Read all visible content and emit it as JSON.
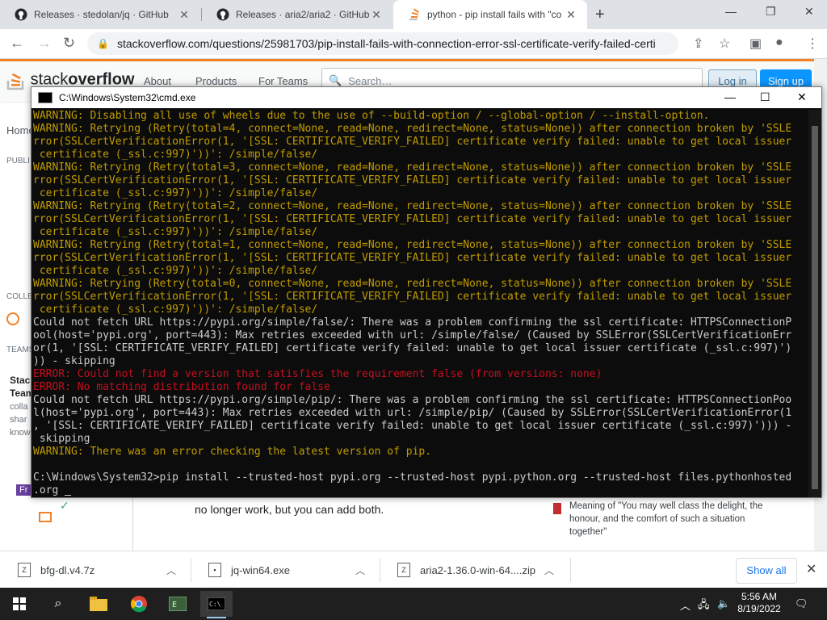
{
  "browser": {
    "tabs": [
      {
        "title": "Releases · stedolan/jq · GitHub",
        "icon": "github-icon"
      },
      {
        "title": "Releases · aria2/aria2 · GitHub",
        "icon": "github-icon"
      },
      {
        "title": "python - pip install fails with \"co",
        "icon": "stackoverflow-icon"
      }
    ],
    "new_tab": "+",
    "url": "stackoverflow.com/questions/25981703/pip-install-fails-with-connection-error-ssl-certificate-verify-failed-certi"
  },
  "so": {
    "logo_a": "stack",
    "logo_b": "overflow",
    "nav": [
      "About",
      "Products",
      "For Teams"
    ],
    "search_placeholder": "Search…",
    "login": "Log in",
    "signup": "Sign up",
    "sidebar": {
      "home": "Home",
      "publi": "PUBLI",
      "colle": "COLLE",
      "teams": "TEAMS",
      "stac": "Stac",
      "team": "Team",
      "colla": "colla",
      "shar": "shar",
      "know": "know",
      "fr": "Fr"
    },
    "answer_text": "no longer work, but you can add both.",
    "meaning_text": "Meaning of \"You may well class the delight, the honour, and the comfort of such a situation together\""
  },
  "cmd": {
    "title": "C:\\Windows\\System32\\cmd.exe",
    "lines": [
      {
        "t": "WARNING: Disabling all use of wheels due to the use of --build-option / --global-option / --install-option.",
        "c": "c-warn"
      },
      {
        "t": "WARNING: Retrying (Retry(total=4, connect=None, read=None, redirect=None, status=None)) after connection broken by 'SSLE",
        "c": "c-warn"
      },
      {
        "t": "rror(SSLCertVerificationError(1, '[SSL: CERTIFICATE_VERIFY_FAILED] certificate verify failed: unable to get local issuer",
        "c": "c-warn"
      },
      {
        "t": " certificate (_ssl.c:997)'))': /simple/false/",
        "c": "c-warn"
      },
      {
        "t": "WARNING: Retrying (Retry(total=3, connect=None, read=None, redirect=None, status=None)) after connection broken by 'SSLE",
        "c": "c-warn"
      },
      {
        "t": "rror(SSLCertVerificationError(1, '[SSL: CERTIFICATE_VERIFY_FAILED] certificate verify failed: unable to get local issuer",
        "c": "c-warn"
      },
      {
        "t": " certificate (_ssl.c:997)'))': /simple/false/",
        "c": "c-warn"
      },
      {
        "t": "WARNING: Retrying (Retry(total=2, connect=None, read=None, redirect=None, status=None)) after connection broken by 'SSLE",
        "c": "c-warn"
      },
      {
        "t": "rror(SSLCertVerificationError(1, '[SSL: CERTIFICATE_VERIFY_FAILED] certificate verify failed: unable to get local issuer",
        "c": "c-warn"
      },
      {
        "t": " certificate (_ssl.c:997)'))': /simple/false/",
        "c": "c-warn"
      },
      {
        "t": "WARNING: Retrying (Retry(total=1, connect=None, read=None, redirect=None, status=None)) after connection broken by 'SSLE",
        "c": "c-warn"
      },
      {
        "t": "rror(SSLCertVerificationError(1, '[SSL: CERTIFICATE_VERIFY_FAILED] certificate verify failed: unable to get local issuer",
        "c": "c-warn"
      },
      {
        "t": " certificate (_ssl.c:997)'))': /simple/false/",
        "c": "c-warn"
      },
      {
        "t": "WARNING: Retrying (Retry(total=0, connect=None, read=None, redirect=None, status=None)) after connection broken by 'SSLE",
        "c": "c-warn"
      },
      {
        "t": "rror(SSLCertVerificationError(1, '[SSL: CERTIFICATE_VERIFY_FAILED] certificate verify failed: unable to get local issuer",
        "c": "c-warn"
      },
      {
        "t": " certificate (_ssl.c:997)'))': /simple/false/",
        "c": "c-warn"
      },
      {
        "t": "Could not fetch URL https://pypi.org/simple/false/: There was a problem confirming the ssl certificate: HTTPSConnectionP",
        "c": "c-white"
      },
      {
        "t": "ool(host='pypi.org', port=443): Max retries exceeded with url: /simple/false/ (Caused by SSLError(SSLCertVerificationErr",
        "c": "c-white"
      },
      {
        "t": "or(1, '[SSL: CERTIFICATE_VERIFY_FAILED] certificate verify failed: unable to get local issuer certificate (_ssl.c:997)')",
        "c": "c-white"
      },
      {
        "t": ")) - skipping",
        "c": "c-white"
      },
      {
        "t": "ERROR: Could not find a version that satisfies the requirement false (from versions: none)",
        "c": "c-err"
      },
      {
        "t": "ERROR: No matching distribution found for false",
        "c": "c-err"
      },
      {
        "t": "Could not fetch URL https://pypi.org/simple/pip/: There was a problem confirming the ssl certificate: HTTPSConnectionPoo",
        "c": "c-white"
      },
      {
        "t": "l(host='pypi.org', port=443): Max retries exceeded with url: /simple/pip/ (Caused by SSLError(SSLCertVerificationError(1",
        "c": "c-white"
      },
      {
        "t": ", '[SSL: CERTIFICATE_VERIFY_FAILED] certificate verify failed: unable to get local issuer certificate (_ssl.c:997)'))) -",
        "c": "c-white"
      },
      {
        "t": " skipping",
        "c": "c-white"
      },
      {
        "t": "WARNING: There was an error checking the latest version of pip.",
        "c": "c-warn"
      },
      {
        "t": "",
        "c": "c-white"
      },
      {
        "t": "C:\\Windows\\System32>pip install --trusted-host pypi.org --trusted-host pypi.python.org --trusted-host files.pythonhosted",
        "c": "c-white"
      },
      {
        "t": ".org ",
        "c": "c-white"
      }
    ]
  },
  "downloads": [
    {
      "name": "bfg-dl.v4.7z"
    },
    {
      "name": "jq-win64.exe"
    },
    {
      "name": "aria2-1.36.0-win-64....zip"
    }
  ],
  "show_all": "Show all",
  "clock": {
    "time": "5:56 AM",
    "date": "8/19/2022"
  }
}
